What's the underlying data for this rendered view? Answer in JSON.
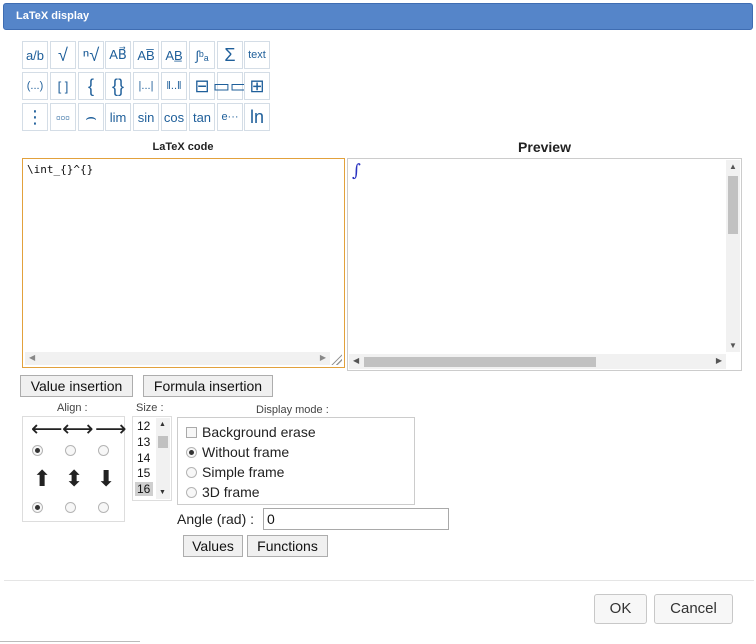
{
  "window": {
    "title": "LaTeX display"
  },
  "palette": {
    "row1": [
      {
        "icon": "fraction-icon",
        "glyph": "a/b"
      },
      {
        "icon": "sqrt-icon",
        "glyph": "√"
      },
      {
        "icon": "nth-root-icon",
        "glyph": "ⁿ√"
      },
      {
        "icon": "vector-icon",
        "glyph": "AB⃗"
      },
      {
        "icon": "overline-icon",
        "glyph": "AB̅"
      },
      {
        "icon": "underline-icon",
        "glyph": "AB̲"
      },
      {
        "icon": "integral-bounds-icon",
        "glyph": "∫ᵇₐ"
      },
      {
        "icon": "sum-icon",
        "glyph": "Σ"
      },
      {
        "icon": "text-icon",
        "glyph": "text"
      }
    ],
    "row2": [
      {
        "icon": "parentheses-icon",
        "glyph": "(...)"
      },
      {
        "icon": "brackets-icon",
        "glyph": "[ ]"
      },
      {
        "icon": "left-brace-icon",
        "glyph": "{"
      },
      {
        "icon": "braces-icon",
        "glyph": "{}"
      },
      {
        "icon": "abs-icon",
        "glyph": "|...|"
      },
      {
        "icon": "norm-icon",
        "glyph": "‖..‖"
      },
      {
        "icon": "column-matrix-icon",
        "glyph": "⊟"
      },
      {
        "icon": "row-matrix-icon",
        "glyph": "▭▭"
      },
      {
        "icon": "grid-matrix-icon",
        "glyph": "⊞"
      }
    ],
    "row3": [
      {
        "icon": "vertical-matrix-icon",
        "glyph": "⋮"
      },
      {
        "icon": "horizontal-matrix-icon",
        "glyph": "▫▫▫"
      },
      {
        "icon": "overbrace-icon",
        "glyph": "⌢"
      },
      {
        "icon": "limit-icon",
        "glyph": "lim"
      },
      {
        "icon": "sin-icon",
        "glyph": "sin"
      },
      {
        "icon": "cos-icon",
        "glyph": "cos"
      },
      {
        "icon": "tan-icon",
        "glyph": "tan"
      },
      {
        "icon": "exp-icon",
        "glyph": "e···"
      },
      {
        "icon": "ln-icon",
        "glyph": "ln"
      }
    ]
  },
  "latex": {
    "label": "LaTeX code",
    "value": "\\int_{}^{}"
  },
  "preview": {
    "label": "Preview",
    "rendered": "∫"
  },
  "buttons": {
    "value_insertion": "Value insertion",
    "formula_insertion": "Formula insertion",
    "values": "Values",
    "functions": "Functions",
    "ok": "OK",
    "cancel": "Cancel"
  },
  "align": {
    "label": "Align :",
    "selected_horizontal": "left",
    "selected_vertical": "top"
  },
  "size": {
    "label": "Size :",
    "options": [
      "12",
      "13",
      "14",
      "15",
      "16"
    ],
    "selected": "16"
  },
  "display_mode": {
    "label": "Display mode :",
    "background_erase": "Background erase",
    "without_frame": "Without frame",
    "simple_frame": "Simple frame",
    "frame_3d": "3D frame",
    "selected": "Without frame"
  },
  "angle": {
    "label": "Angle (rad) :",
    "value": "0"
  }
}
